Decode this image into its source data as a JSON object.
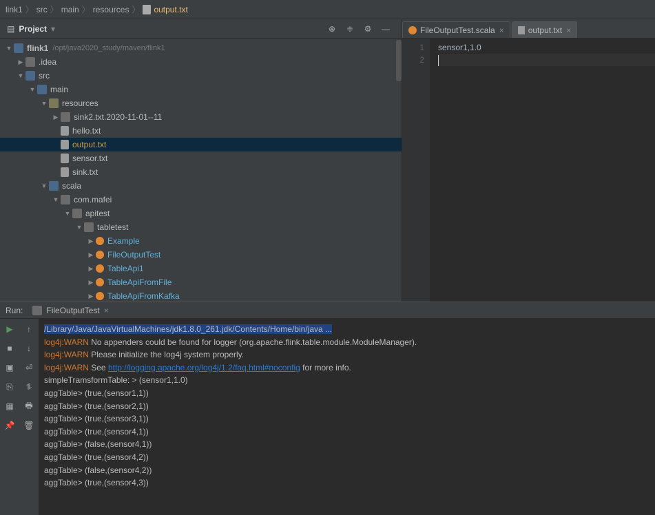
{
  "breadcrumb": [
    "link1",
    "src",
    "main",
    "resources",
    "output.txt"
  ],
  "project": {
    "title": "Project",
    "root": {
      "name": "flink1",
      "path": "/opt/java2020_study/maven/flink1"
    }
  },
  "tree": [
    {
      "indent": 0,
      "tw": "▼",
      "icon": "folderblue",
      "label": "flink1",
      "extra": "/opt/java2020_study/maven/flink1",
      "bold": true
    },
    {
      "indent": 1,
      "tw": "▶",
      "icon": "folderlt",
      "label": ".idea"
    },
    {
      "indent": 1,
      "tw": "▼",
      "icon": "folderblue",
      "label": "src"
    },
    {
      "indent": 2,
      "tw": "▼",
      "icon": "folderblue",
      "label": "main"
    },
    {
      "indent": 3,
      "tw": "▼",
      "icon": "folder",
      "label": "resources"
    },
    {
      "indent": 4,
      "tw": "▶",
      "icon": "folderlt",
      "label": "sink2.txt.2020-11-01--11"
    },
    {
      "indent": 4,
      "tw": "",
      "icon": "file",
      "label": "hello.txt"
    },
    {
      "indent": 4,
      "tw": "",
      "icon": "file",
      "label": "output.txt",
      "selected": true
    },
    {
      "indent": 4,
      "tw": "",
      "icon": "file",
      "label": "sensor.txt"
    },
    {
      "indent": 4,
      "tw": "",
      "icon": "file",
      "label": "sink.txt"
    },
    {
      "indent": 3,
      "tw": "▼",
      "icon": "folderblue",
      "label": "scala"
    },
    {
      "indent": 4,
      "tw": "▼",
      "icon": "folderlt",
      "label": "com.mafei"
    },
    {
      "indent": 5,
      "tw": "▼",
      "icon": "folderlt",
      "label": "apitest"
    },
    {
      "indent": 6,
      "tw": "▼",
      "icon": "folderlt",
      "label": "tabletest"
    },
    {
      "indent": 7,
      "tw": "▶",
      "icon": "scala",
      "label": "Example",
      "hl": true
    },
    {
      "indent": 7,
      "tw": "▶",
      "icon": "scala",
      "label": "FileOutputTest",
      "hl": true
    },
    {
      "indent": 7,
      "tw": "▶",
      "icon": "scala",
      "label": "TableApi1",
      "hl": true
    },
    {
      "indent": 7,
      "tw": "▶",
      "icon": "scala",
      "label": "TableApiFromFile",
      "hl": true
    },
    {
      "indent": 7,
      "tw": "▶",
      "icon": "scala",
      "label": "TableApiFromKafka",
      "hl": true
    }
  ],
  "tabs": [
    {
      "icon": "scala",
      "label": "FileOutputTest.scala",
      "active": false
    },
    {
      "icon": "file",
      "label": "output.txt",
      "active": true
    }
  ],
  "editor": {
    "lines": [
      "sensor1,1.0",
      ""
    ]
  },
  "run": {
    "label": "Run:",
    "tab": "FileOutputTest",
    "console": [
      {
        "t": "hl",
        "text": "/Library/Java/JavaVirtualMachines/jdk1.8.0_261.jdk/Contents/Home/bin/java ..."
      },
      {
        "t": "warn",
        "prefix": "log4j:WARN ",
        "text": "No appenders could be found for logger (org.apache.flink.table.module.ModuleManager)."
      },
      {
        "t": "warn",
        "prefix": "log4j:WARN ",
        "text": "Please initialize the log4j system properly."
      },
      {
        "t": "warnlink",
        "prefix": "log4j:WARN ",
        "lead": "See ",
        "link": "http://logging.apache.org/log4j/1.2/faq.html#noconfig",
        "tail": " for more info."
      },
      {
        "t": "body",
        "text": " simpleTramsformTable: > (sensor1,1.0)"
      },
      {
        "t": "body",
        "text": " aggTable> (true,(sensor1,1))"
      },
      {
        "t": "body",
        "text": " aggTable> (true,(sensor2,1))"
      },
      {
        "t": "body",
        "text": " aggTable> (true,(sensor3,1))"
      },
      {
        "t": "body",
        "text": " aggTable> (true,(sensor4,1))"
      },
      {
        "t": "body",
        "text": " aggTable> (false,(sensor4,1))"
      },
      {
        "t": "body",
        "text": " aggTable> (true,(sensor4,2))"
      },
      {
        "t": "body",
        "text": " aggTable> (false,(sensor4,2))"
      },
      {
        "t": "body",
        "text": " aggTable> (true,(sensor4,3))"
      }
    ]
  }
}
